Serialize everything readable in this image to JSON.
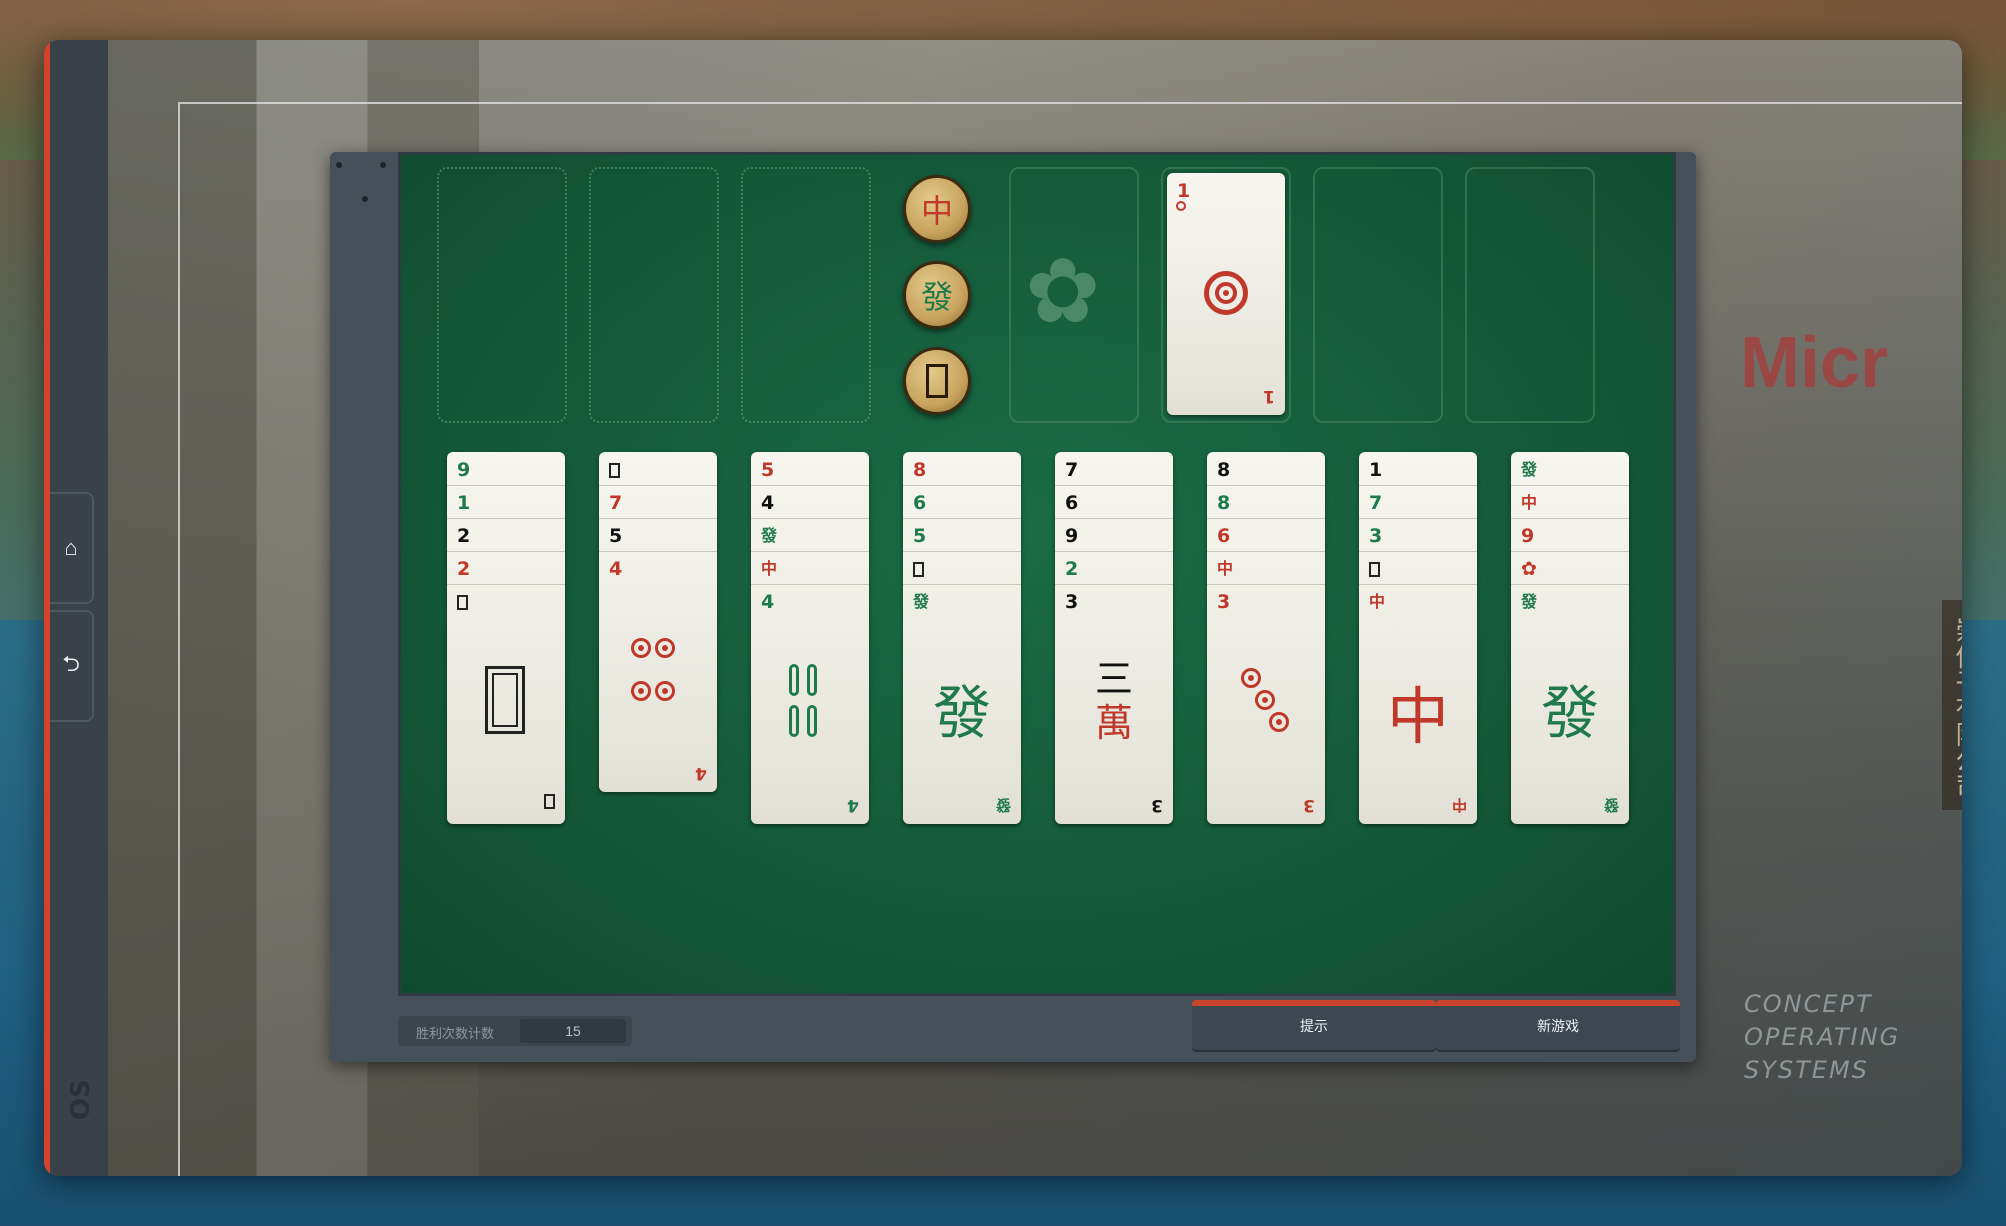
{
  "os": {
    "sidebar": {
      "home_icon": "home-icon",
      "back_icon": "undo-icon",
      "logo": "OS"
    },
    "brand_lines": [
      "CONCEPT",
      "OPERATING",
      "SYSTEMS"
    ],
    "sign_text": "Micr",
    "vertical_sign": "崇信子有限公司"
  },
  "game": {
    "dragon_buttons": [
      {
        "glyph": "中",
        "color": "#c0382a"
      },
      {
        "glyph": "發",
        "color": "#1f7a4a"
      },
      {
        "glyph": "white-dragon-icon"
      }
    ],
    "foundation": {
      "label_top": "1",
      "label_bottom": "1",
      "suit": "coins"
    },
    "columns": [
      {
        "labels": [
          "9",
          "1",
          "2",
          "2"
        ],
        "colors": [
          "green",
          "green",
          "black",
          "red"
        ],
        "top_card": "white-dragon",
        "corner": ""
      },
      {
        "labels": [
          "",
          "7",
          "5",
          "4"
        ],
        "colors": [
          "black",
          "red",
          "black",
          "red"
        ],
        "top_card": "4-coins",
        "corner": "4"
      },
      {
        "labels": [
          "5",
          "4",
          "發",
          "中",
          "4"
        ],
        "colors": [
          "red",
          "black",
          "green",
          "red",
          "green"
        ],
        "top_card": "4-bamboo",
        "corner": "4"
      },
      {
        "labels": [
          "8",
          "6",
          "5",
          "",
          "發"
        ],
        "colors": [
          "red",
          "green",
          "green",
          "black",
          "green"
        ],
        "top_card": "green-dragon",
        "corner": "發"
      },
      {
        "labels": [
          "7",
          "6",
          "9",
          "2",
          "3"
        ],
        "colors": [
          "black",
          "black",
          "black",
          "green",
          "black"
        ],
        "top_card": "3-characters",
        "corner": "3"
      },
      {
        "labels": [
          "8",
          "8",
          "6",
          "中",
          "3"
        ],
        "colors": [
          "black",
          "green",
          "red",
          "red",
          "red"
        ],
        "top_card": "3-coins",
        "corner": "3"
      },
      {
        "labels": [
          "1",
          "7",
          "3",
          "",
          "中"
        ],
        "colors": [
          "black",
          "green",
          "green",
          "black",
          "red"
        ],
        "top_card": "red-dragon",
        "corner": "中"
      },
      {
        "labels": [
          "發",
          "中",
          "9",
          "",
          "發"
        ],
        "colors": [
          "green",
          "red",
          "red",
          "red",
          "green"
        ],
        "top_card": "green-dragon",
        "corner": "發"
      }
    ],
    "big_glyphs": {
      "red_dragon": "中",
      "green_dragon": "發",
      "three": "三",
      "wan": "萬"
    },
    "win_counter": {
      "label": "胜利次数计数",
      "value": "15"
    },
    "hint_button": "提示",
    "new_game_button": "新游戏"
  }
}
